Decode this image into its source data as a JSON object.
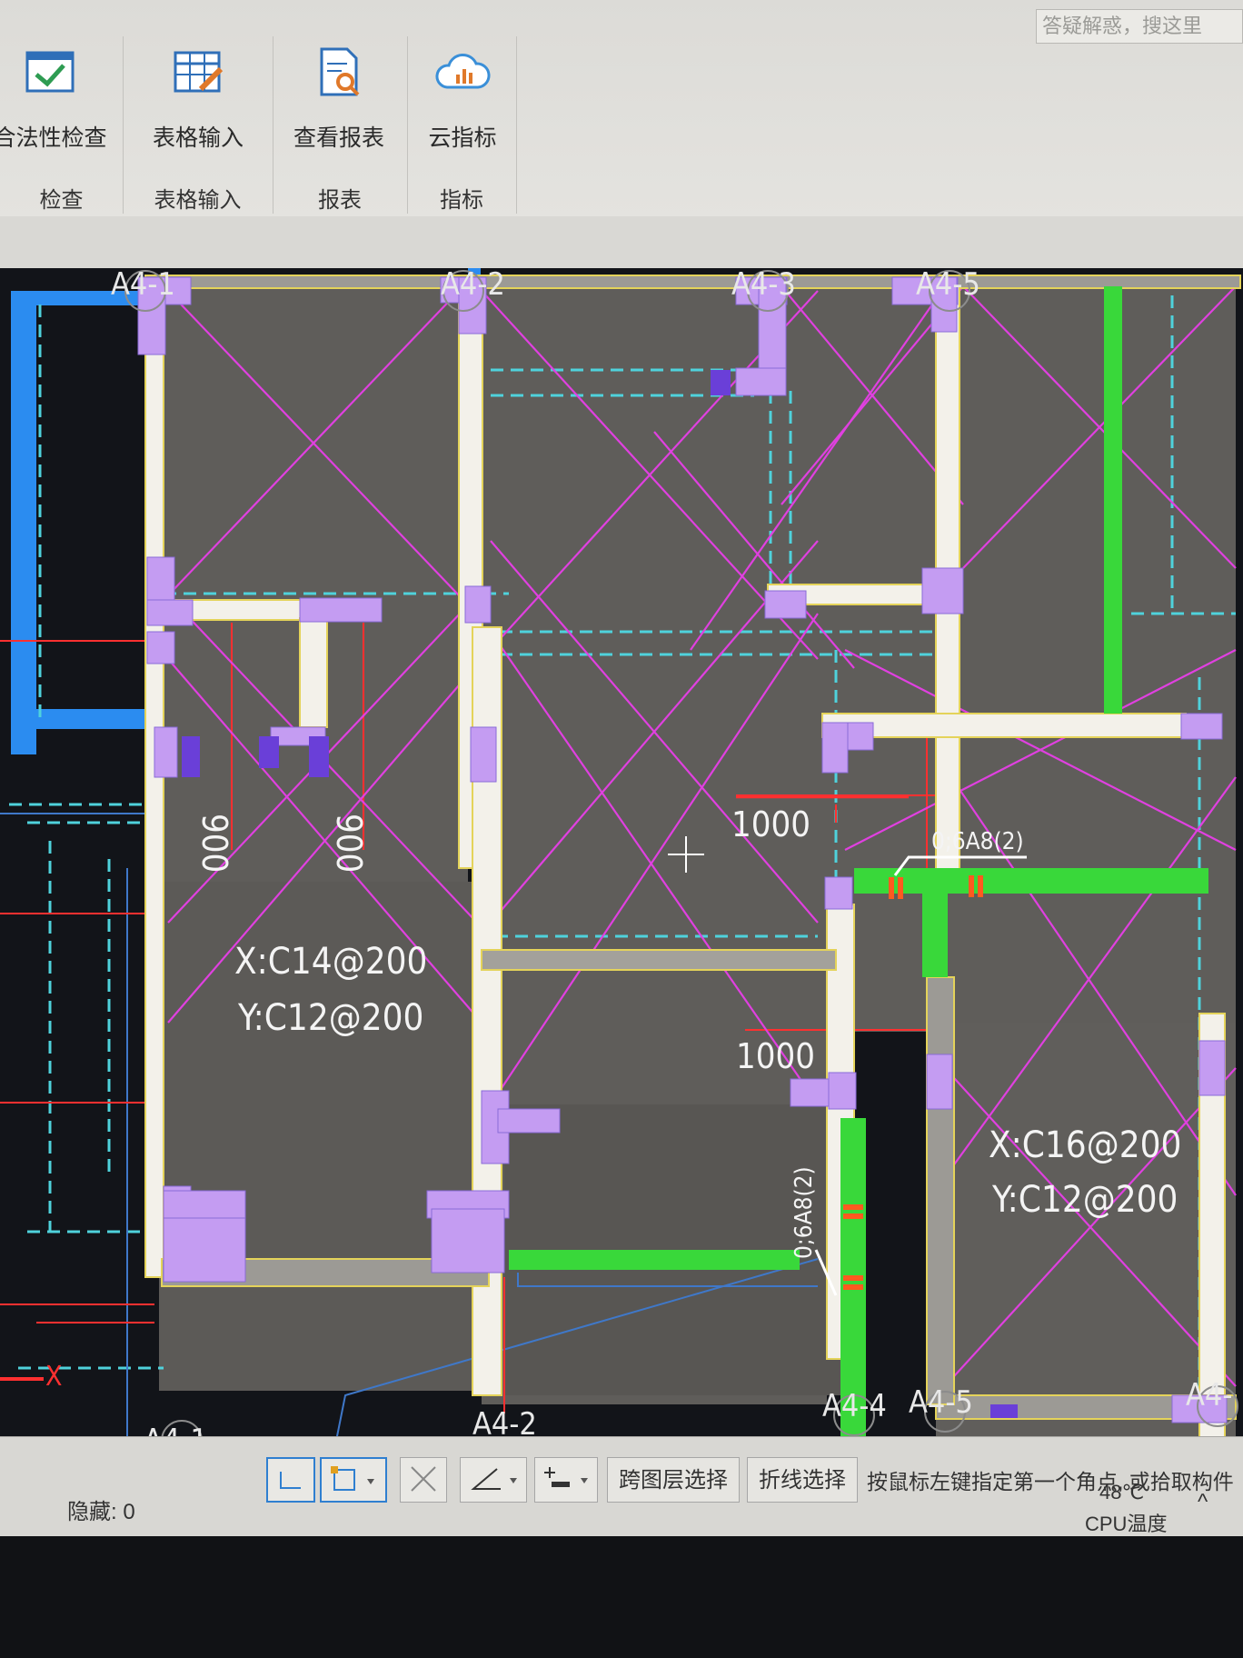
{
  "ribbon": {
    "search_placeholder": "答疑解惑，搜这里",
    "groups": [
      {
        "label": "检查",
        "button": "合法性检查"
      },
      {
        "label": "表格输入",
        "button": "表格输入"
      },
      {
        "label": "报表",
        "button": "查看报表"
      },
      {
        "label": "指标",
        "button": "云指标"
      }
    ]
  },
  "drawing": {
    "axes_top": [
      "A4-1",
      "A4-2",
      "A4-3",
      "A4-5"
    ],
    "axes_bottom": [
      "A4-1",
      "A4-2",
      "A4-4",
      "A4-5",
      "A4-"
    ],
    "dimensions": {
      "left_a": "900",
      "left_b": "900",
      "mid_top": "1000",
      "mid_bottom": "1000"
    },
    "slab_left": {
      "x_rebar": "X:C14@200",
      "y_rebar": "Y:C12@200"
    },
    "slab_right": {
      "x_rebar": "X:C16@200",
      "y_rebar": "Y:C12@200"
    },
    "stirrup_a": "0;6A8(2)",
    "stirrup_b": "0;6A8(2)",
    "ucs_marker": "X",
    "colors": {
      "slab": "#5f5d5a",
      "wall": "#f3f1ea",
      "column": "#c49cf2",
      "beam_green": "#39d83a",
      "diagonal": "#e040e0",
      "dashed": "#4fd2dc",
      "dim_line": "#ff3030",
      "blue_member": "#2b8cf0"
    }
  },
  "statusbar": {
    "hidden_count": "隐藏: 0",
    "cross_layer": "跨图层选择",
    "polyline": "折线选择",
    "prompt": "按鼠标左键指定第一个角点, 或拾取构件",
    "cpu_temp": "48℃",
    "cpu_label": "CPU温度",
    "chevron": "^"
  }
}
